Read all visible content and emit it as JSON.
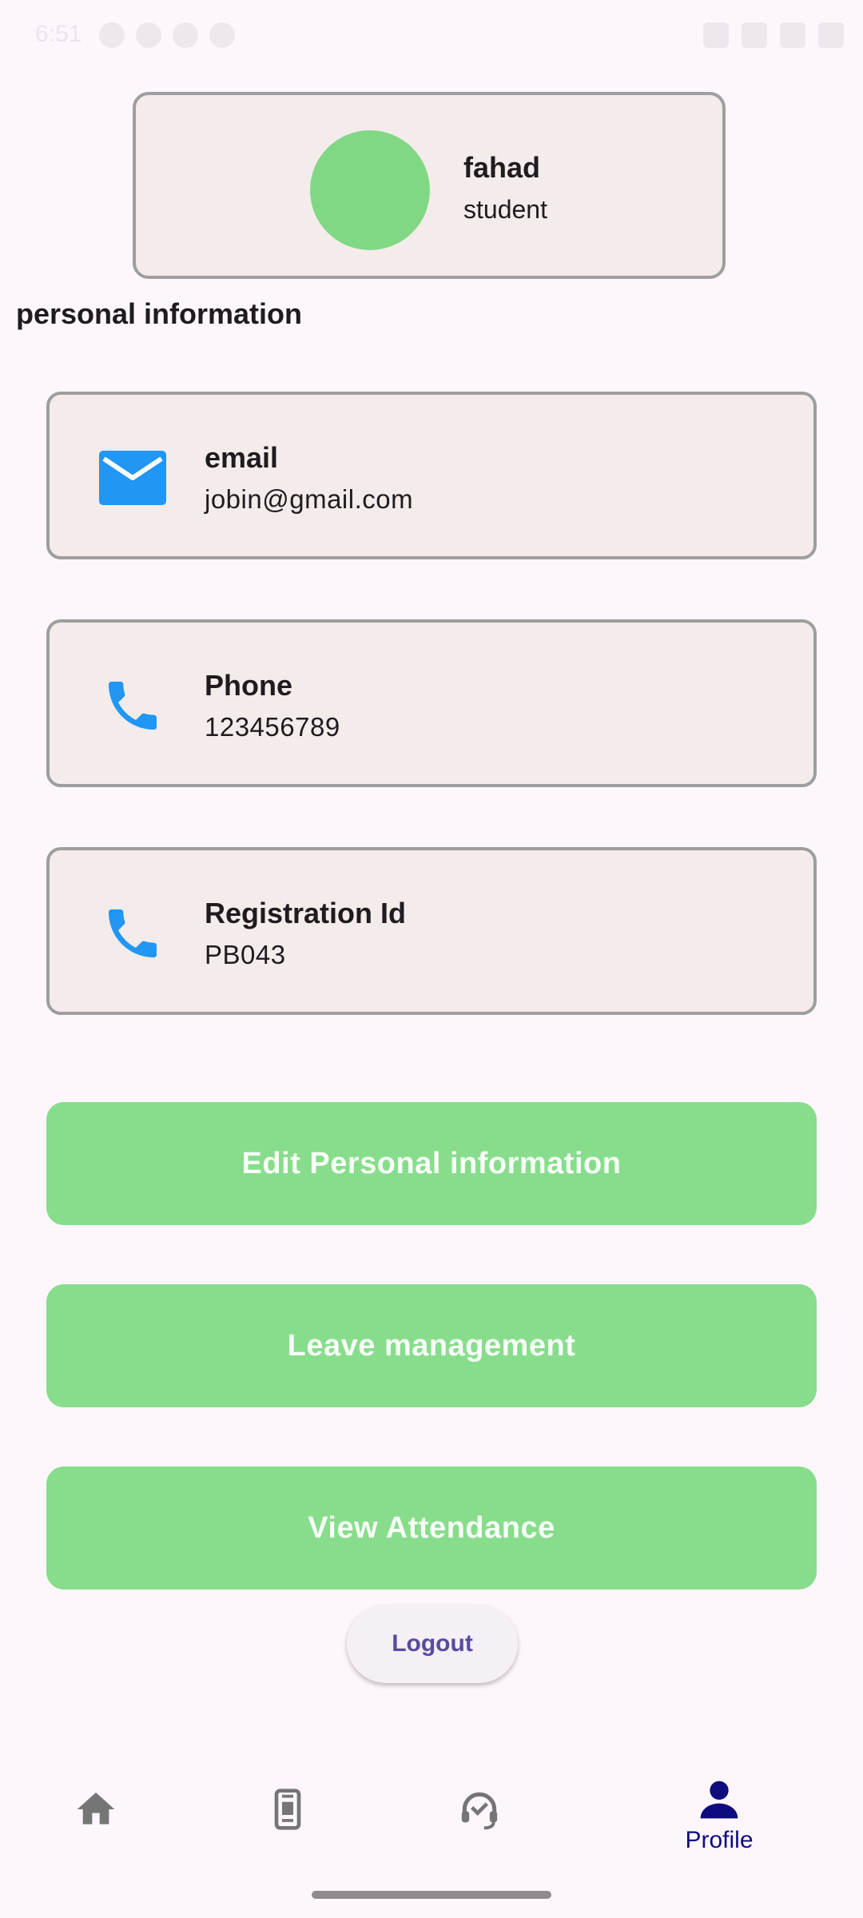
{
  "status_bar": {
    "time": "6:51"
  },
  "profile": {
    "name": "fahad",
    "role": "student",
    "avatar_color": "#81D884"
  },
  "section_title": "personal information",
  "info_cards": [
    {
      "icon": "email-icon",
      "label": "email",
      "value": "jobin@gmail.com"
    },
    {
      "icon": "phone-icon",
      "label": "Phone",
      "value": "123456789"
    },
    {
      "icon": "phone-icon",
      "label": "Registration Id",
      "value": "PB043"
    }
  ],
  "actions": {
    "edit_label": "Edit Personal information",
    "leave_label": "Leave management",
    "attendance_label": "View Attendance",
    "logout_label": "Logout"
  },
  "bottom_nav": {
    "items": [
      {
        "icon": "home-icon",
        "label": ""
      },
      {
        "icon": "book-icon",
        "label": ""
      },
      {
        "icon": "support-headset-icon",
        "label": ""
      },
      {
        "icon": "person-icon",
        "label": "Profile",
        "selected": true
      }
    ]
  },
  "colors": {
    "accent_green": "#87DD8B",
    "icon_blue": "#2196F3",
    "nav_selected": "#0E0C7E",
    "nav_inactive": "#757575"
  }
}
